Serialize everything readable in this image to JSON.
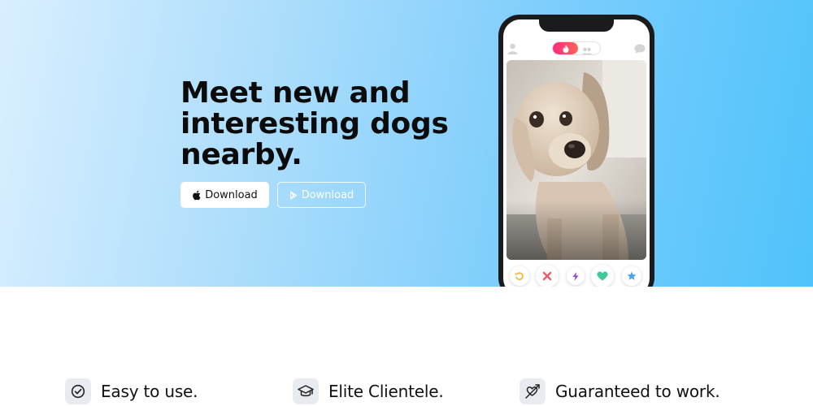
{
  "hero": {
    "headline": "Meet new and interesting dogs nearby.",
    "download_ios_label": "Download",
    "download_play_label": "Download"
  },
  "phone": {
    "mode_toggle": {
      "active": "flame",
      "inactive": "people"
    },
    "actions": [
      "rewind",
      "nope",
      "boost",
      "like",
      "super-like"
    ]
  },
  "features": [
    {
      "label": "Easy to use.",
      "icon": "check-circle-icon"
    },
    {
      "label": "Elite Clientele.",
      "icon": "graduation-cap-icon"
    },
    {
      "label": "Guaranteed to work.",
      "icon": "heart-arrow-icon"
    }
  ],
  "colors": {
    "hero_gradient_start": "#d9efff",
    "hero_gradient_end": "#4fc3fb",
    "brand_pink": "#fd297b",
    "nope_red": "#ec5e6f",
    "like_green": "#3ec99a",
    "super_blue": "#4da3e8",
    "rewind_yellow": "#f5b748",
    "boost_purple": "#8e4bd1"
  }
}
